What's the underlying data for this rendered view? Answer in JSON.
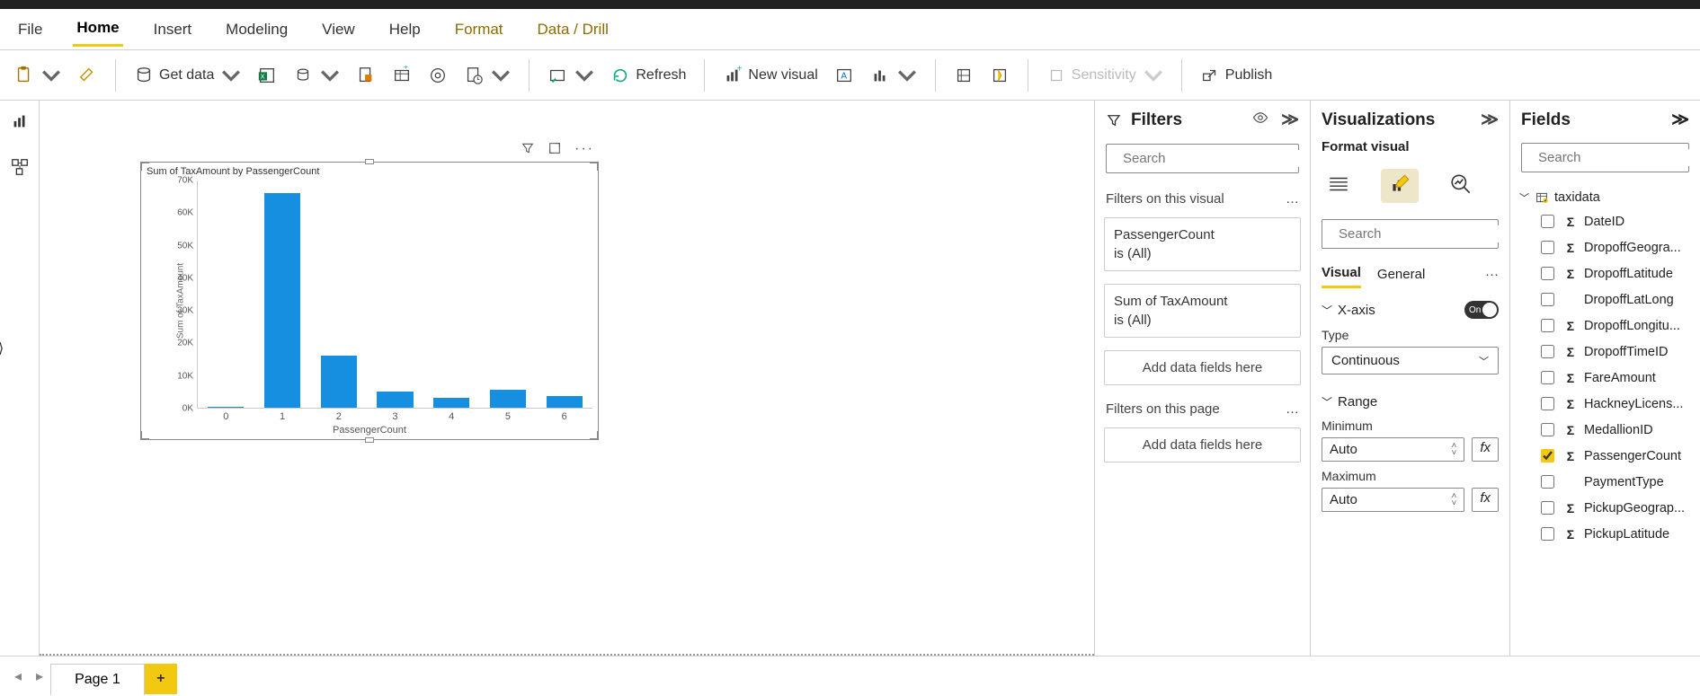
{
  "menu": {
    "file": "File",
    "home": "Home",
    "insert": "Insert",
    "modeling": "Modeling",
    "view": "View",
    "help": "Help",
    "format": "Format",
    "datadrill": "Data / Drill"
  },
  "ribbon": {
    "getdata": "Get data",
    "refresh": "Refresh",
    "newvisual": "New visual",
    "sensitivity": "Sensitivity",
    "publish": "Publish"
  },
  "visual_header": {
    "filter_icon": "filter",
    "focus_icon": "focus-mode",
    "more_icon": "more"
  },
  "chart_data": {
    "type": "bar",
    "title": "Sum of TaxAmount by PassengerCount",
    "xlabel": "PassengerCount",
    "ylabel": "Sum of TaxAmount",
    "categories": [
      "0",
      "1",
      "2",
      "3",
      "4",
      "5",
      "6"
    ],
    "values": [
      200,
      66000,
      16000,
      5000,
      3000,
      5500,
      3500
    ],
    "ylim": [
      0,
      70000
    ],
    "yticks": [
      "0K",
      "10K",
      "20K",
      "30K",
      "40K",
      "50K",
      "60K",
      "70K"
    ]
  },
  "filters": {
    "title": "Filters",
    "search_placeholder": "Search",
    "section_visual": "Filters on this visual",
    "section_page": "Filters on this page",
    "items": [
      {
        "name": "PassengerCount",
        "state": "is (All)"
      },
      {
        "name": "Sum of TaxAmount",
        "state": "is (All)"
      }
    ],
    "add_hint": "Add data fields here"
  },
  "viz": {
    "title": "Visualizations",
    "subtitle": "Format visual",
    "search_placeholder": "Search",
    "tab_visual": "Visual",
    "tab_general": "General",
    "group_xaxis": "X-axis",
    "toggle_on": "On",
    "type_label": "Type",
    "type_value": "Continuous",
    "group_range": "Range",
    "min_label": "Minimum",
    "max_label": "Maximum",
    "auto": "Auto",
    "fx": "fx"
  },
  "fields": {
    "title": "Fields",
    "search_placeholder": "Search",
    "table": "taxidata",
    "rows": [
      {
        "name": "DateID",
        "sigma": true,
        "checked": false
      },
      {
        "name": "DropoffGeogra...",
        "sigma": true,
        "checked": false
      },
      {
        "name": "DropoffLatitude",
        "sigma": true,
        "checked": false
      },
      {
        "name": "DropoffLatLong",
        "sigma": false,
        "checked": false
      },
      {
        "name": "DropoffLongitu...",
        "sigma": true,
        "checked": false
      },
      {
        "name": "DropoffTimeID",
        "sigma": true,
        "checked": false
      },
      {
        "name": "FareAmount",
        "sigma": true,
        "checked": false
      },
      {
        "name": "HackneyLicens...",
        "sigma": true,
        "checked": false
      },
      {
        "name": "MedallionID",
        "sigma": true,
        "checked": false
      },
      {
        "name": "PassengerCount",
        "sigma": true,
        "checked": true
      },
      {
        "name": "PaymentType",
        "sigma": false,
        "checked": false
      },
      {
        "name": "PickupGeograp...",
        "sigma": true,
        "checked": false
      },
      {
        "name": "PickupLatitude",
        "sigma": true,
        "checked": false
      }
    ]
  },
  "footer": {
    "page": "Page 1"
  }
}
